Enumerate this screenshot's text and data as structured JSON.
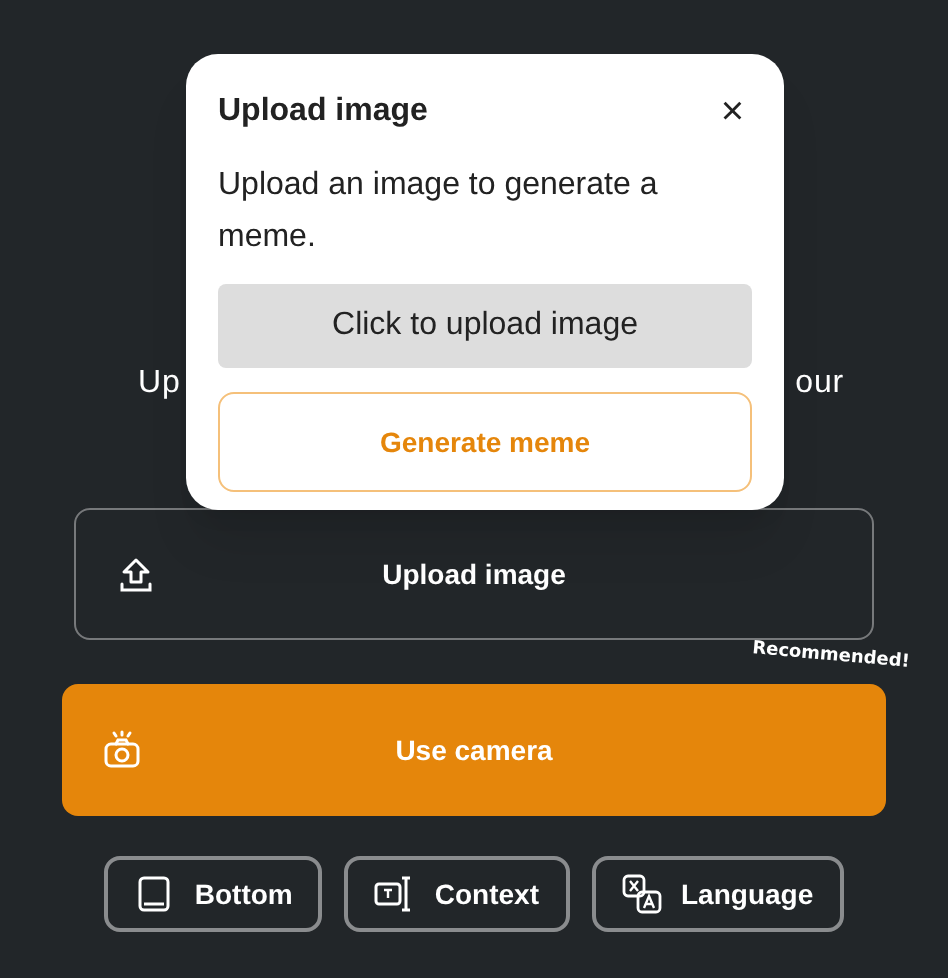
{
  "background_text": {
    "visible_start": "Up",
    "visible_end": "our"
  },
  "actions": [
    {
      "kind": "upload",
      "label": "Upload image",
      "primary": false
    },
    {
      "kind": "camera",
      "label": "Use camera",
      "primary": true,
      "badge": "Recommended!"
    }
  ],
  "options": [
    {
      "kind": "bottom",
      "label": "Bottom"
    },
    {
      "kind": "context",
      "label": "Context"
    },
    {
      "kind": "language",
      "label": "Language"
    }
  ],
  "dialog": {
    "title": "Upload image",
    "close": "×",
    "description": "Upload an image to generate a meme.",
    "upload_button": "Click to upload image",
    "generate_button": "Generate meme"
  }
}
